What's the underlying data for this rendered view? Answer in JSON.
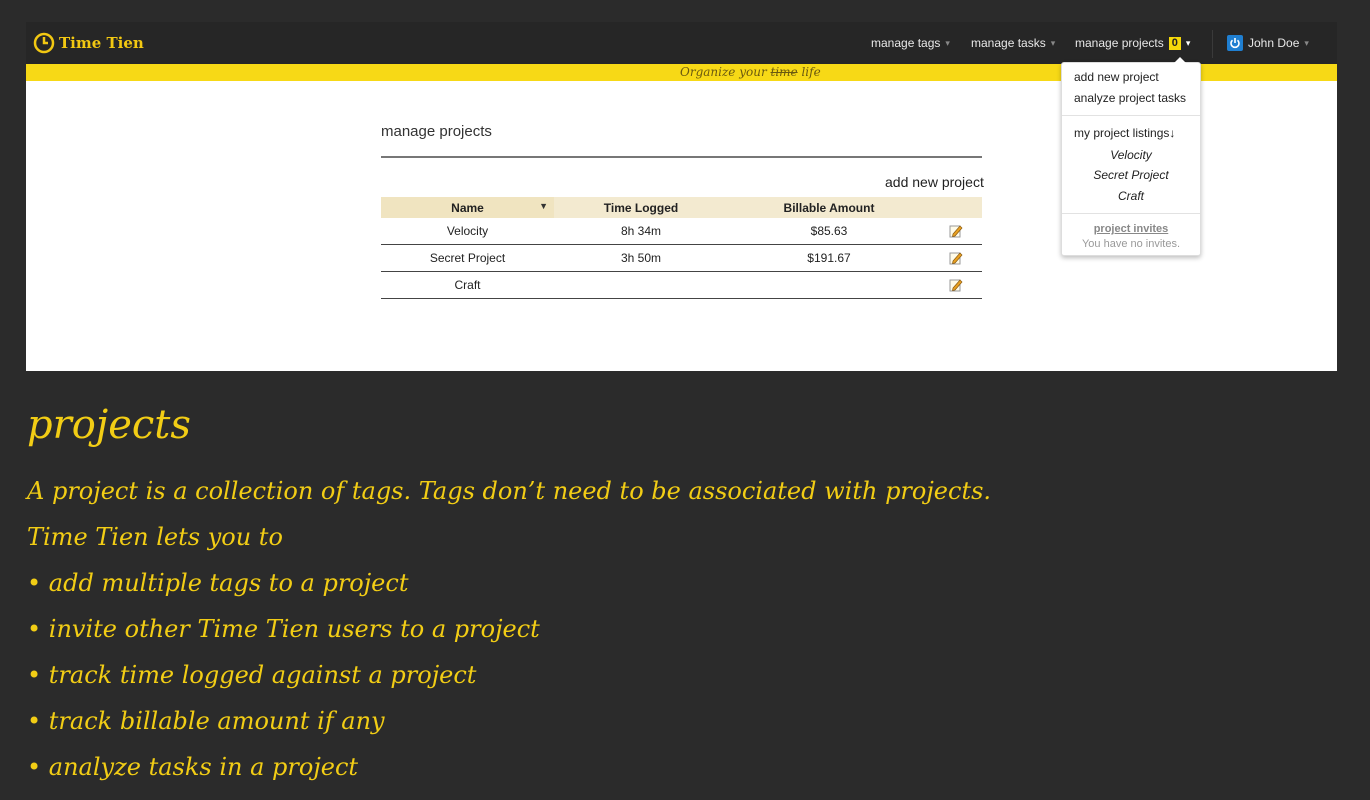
{
  "app": {
    "brand": "Time Tien",
    "tagline_prefix": "Organize your ",
    "tagline_struck": "time",
    "tagline_suffix": " life"
  },
  "nav": {
    "tags": "manage tags",
    "tasks": "manage tasks",
    "projects": "manage projects",
    "projects_count": "0",
    "user": "John Doe"
  },
  "dropdown": {
    "add_new": "add new project",
    "analyze": "analyze project tasks",
    "listings_label": "my project listings↓",
    "projects": [
      "Velocity",
      "Secret Project",
      "Craft"
    ],
    "invites_label": "project invites",
    "no_invites": "You have no invites."
  },
  "page": {
    "title": "manage projects",
    "add_link": "add new project",
    "columns": [
      "Name",
      "Time Logged",
      "Billable Amount"
    ],
    "rows": [
      {
        "name": "Velocity",
        "time": "8h 34m",
        "amount": "$85.63"
      },
      {
        "name": "Secret Project",
        "time": "3h 50m",
        "amount": "$191.67"
      },
      {
        "name": "Craft",
        "time": "",
        "amount": ""
      }
    ]
  },
  "caption": {
    "title": "projects",
    "lines": [
      "A project is a collection of tags. Tags don’t need to be associated with projects.",
      "Time Tien lets you to",
      "• add multiple tags to a project",
      "• invite other Time Tien users to a project",
      "• track time logged against a project",
      "• track billable amount if any",
      "• analyze tasks in a project"
    ]
  },
  "colors": {
    "accent": "#f7d916",
    "navbar": "#262626",
    "background": "#2b2b2b",
    "caption": "#f2cd15"
  }
}
